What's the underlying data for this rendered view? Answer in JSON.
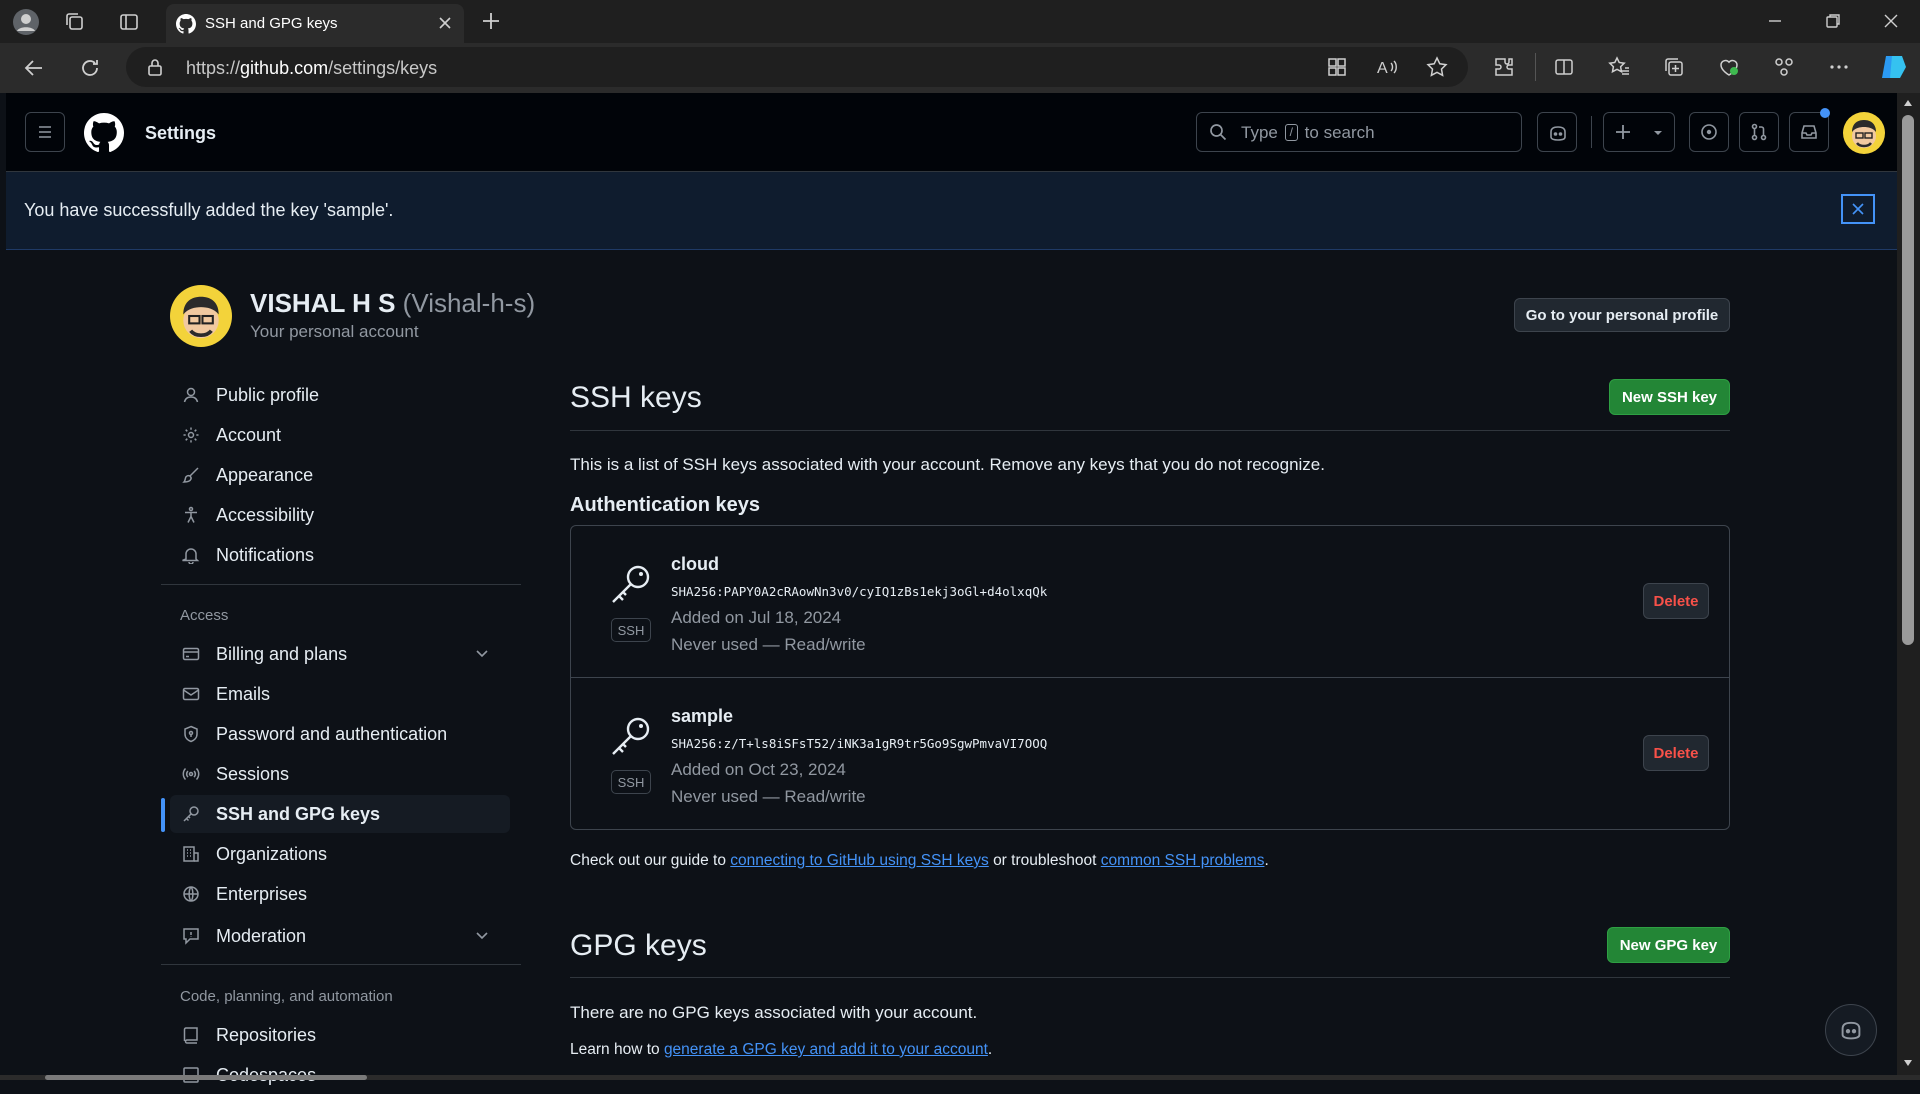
{
  "browser": {
    "tab_title": "SSH and GPG keys",
    "url_prefix": "https://",
    "url_host": "github.com",
    "url_path": "/settings/keys"
  },
  "header": {
    "title": "Settings",
    "search_pre": "Type",
    "search_key": "/",
    "search_post": "to search"
  },
  "flash": {
    "message": "You have successfully added the key 'sample'."
  },
  "profile": {
    "name": "VISHAL H S",
    "login": "(Vishal-h-s)",
    "subtitle": "Your personal account",
    "go_button": "Go to your personal profile"
  },
  "sidebar": {
    "items": [
      {
        "label": "Public profile",
        "icon": "person-icon"
      },
      {
        "label": "Account",
        "icon": "gear-icon"
      },
      {
        "label": "Appearance",
        "icon": "paintbrush-icon"
      },
      {
        "label": "Accessibility",
        "icon": "accessibility-icon"
      },
      {
        "label": "Notifications",
        "icon": "bell-icon"
      }
    ],
    "access_heading": "Access",
    "access_items": [
      {
        "label": "Billing and plans",
        "icon": "credit-card-icon"
      },
      {
        "label": "Emails",
        "icon": "mail-icon"
      },
      {
        "label": "Password and authentication",
        "icon": "shield-lock-icon"
      },
      {
        "label": "Sessions",
        "icon": "broadcast-icon"
      },
      {
        "label": "SSH and GPG keys",
        "icon": "key-icon"
      },
      {
        "label": "Organizations",
        "icon": "organization-icon"
      },
      {
        "label": "Enterprises",
        "icon": "globe-icon"
      },
      {
        "label": "Moderation",
        "icon": "report-icon"
      }
    ],
    "code_heading": "Code, planning, and automation",
    "code_items": [
      {
        "label": "Repositories",
        "icon": "repo-icon"
      },
      {
        "label": "Codespaces",
        "icon": "codespaces-icon"
      }
    ]
  },
  "ssh": {
    "heading": "SSH keys",
    "new_button": "New SSH key",
    "description": "This is a list of SSH keys associated with your account. Remove any keys that you do not recognize.",
    "auth_heading": "Authentication keys",
    "keys": [
      {
        "name": "cloud",
        "badge": "SSH",
        "fingerprint": "SHA256:PAPY0A2cRAowNn3v0/cyIQ1zBs1ekj3oGl+d4olxqQk",
        "added": "Added on Jul 18, 2024",
        "usage": "Never used — Read/write",
        "delete": "Delete"
      },
      {
        "name": "sample",
        "badge": "SSH",
        "fingerprint": "SHA256:z/T+ls8iSFsT52/iNK3a1gR9tr5Go9SgwPmvaVI7OOQ",
        "added": "Added on Oct 23, 2024",
        "usage": "Never used — Read/write",
        "delete": "Delete"
      }
    ],
    "guide_pre": "Check out our guide to",
    "guide_link": "connecting to GitHub using SSH keys",
    "guide_mid": "or troubleshoot",
    "guide_link2": "common SSH problems",
    "guide_post": "."
  },
  "gpg": {
    "heading": "GPG keys",
    "new_button": "New GPG key",
    "empty": "There are no GPG keys associated with your account.",
    "learn_pre": "Learn how to",
    "learn_link": "generate a GPG key and add it to your account",
    "learn_post": "."
  },
  "colors": {
    "accent": "#4493f8",
    "green": "#238636",
    "danger": "#f85149",
    "bg": "#0d1117"
  }
}
